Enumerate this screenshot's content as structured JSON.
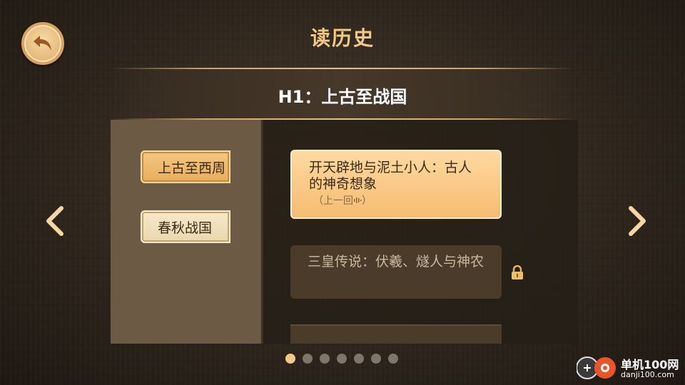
{
  "header": {
    "title": "读历史",
    "back_icon": "back-arrow-icon"
  },
  "banner": {
    "title": "H1：上古至战国"
  },
  "sidebar": {
    "tabs": [
      {
        "label": "上古至西周",
        "active": true
      },
      {
        "label": "春秋战国",
        "active": false
      }
    ]
  },
  "lessons": [
    {
      "title": "开天辟地与泥土小人：古人的神奇想象",
      "subtitle": "（上一回",
      "audio_icon": "audio-wave-icon",
      "subtitle_end": "）",
      "locked": false
    },
    {
      "title": "三皇传说：伏羲、燧人与神农",
      "locked": true,
      "lock_icon": "lock-icon"
    }
  ],
  "pagination": {
    "total": 7,
    "current": 1
  },
  "colors": {
    "accent": "#f3c988",
    "active_tab": "#e9ad5d",
    "locked_card": "#4a3b2b"
  },
  "watermark": {
    "text": "单机100网",
    "url": "danji100.com"
  }
}
